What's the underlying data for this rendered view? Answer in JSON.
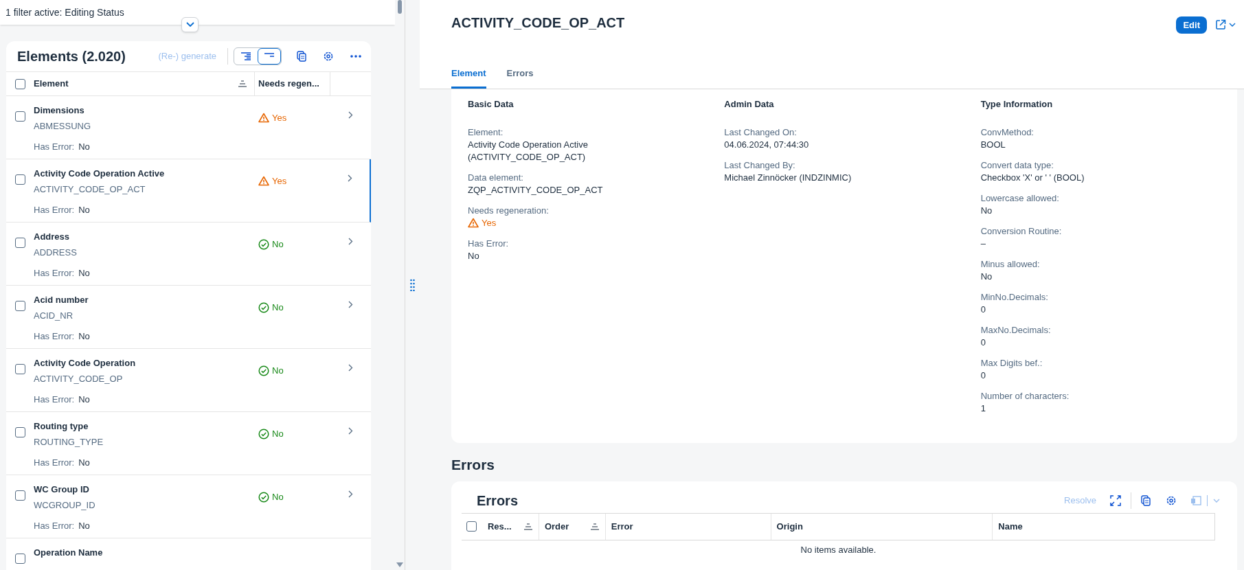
{
  "filter_bar": {
    "text": "1 filter active: Editing Status"
  },
  "elements_table": {
    "title": "Elements (2.020)",
    "generate_button": "(Re-) generate",
    "view_modes": [
      {
        "selected": false
      },
      {
        "selected": true
      }
    ],
    "select_all_checked": false,
    "columns": [
      "Element",
      "Needs regen..."
    ],
    "rows": [
      {
        "name": "Dimensions",
        "code": "ABMESSUNG",
        "needs_regeneration": true,
        "status": "Yes",
        "has_error_label": "Has Error:",
        "has_error": "No",
        "selected": false
      },
      {
        "name": "Activity Code Operation Active",
        "code": "ACTIVITY_CODE_OP_ACT",
        "needs_regeneration": true,
        "status": "Yes",
        "has_error_label": "Has Error:",
        "has_error": "No",
        "selected": true
      },
      {
        "name": "Address",
        "code": "ADDRESS",
        "needs_regeneration": false,
        "status": "No",
        "has_error_label": "Has Error:",
        "has_error": "No",
        "selected": false
      },
      {
        "name": "Acid number",
        "code": "ACID_NR",
        "needs_regeneration": false,
        "status": "No",
        "has_error_label": "Has Error:",
        "has_error": "No",
        "selected": false
      },
      {
        "name": "Activity Code Operation",
        "code": "ACTIVITY_CODE_OP",
        "needs_regeneration": false,
        "status": "No",
        "has_error_label": "Has Error:",
        "has_error": "No",
        "selected": false
      },
      {
        "name": "Routing type",
        "code": "ROUTING_TYPE",
        "needs_regeneration": false,
        "status": "No",
        "has_error_label": "Has Error:",
        "has_error": "No",
        "selected": false
      },
      {
        "name": "WC Group ID",
        "code": "WCGROUP_ID",
        "needs_regeneration": false,
        "status": "No",
        "has_error_label": "Has Error:",
        "has_error": "No",
        "selected": false
      },
      {
        "name": "Operation Name",
        "selected": false
      }
    ]
  },
  "detail": {
    "title": "ACTIVITY_CODE_OP_ACT",
    "edit_button": "Edit",
    "tabs": [
      {
        "label": "Element",
        "selected": true
      },
      {
        "label": "Errors",
        "selected": false
      }
    ],
    "groups": [
      {
        "title": "Basic Data",
        "fields": [
          {
            "label": "Element:",
            "value": "Activity Code Operation Active (ACTIVITY_CODE_OP_ACT)",
            "kind": "text"
          },
          {
            "label": "Data element:",
            "value": "ZQP_ACTIVITY_CODE_OP_ACT",
            "kind": "text"
          },
          {
            "label": "Needs regeneration:",
            "value": "Yes",
            "kind": "warning"
          },
          {
            "label": "Has Error:",
            "value": "No",
            "kind": "text"
          }
        ]
      },
      {
        "title": "Admin Data",
        "fields": [
          {
            "label": "Last Changed On:",
            "value": "04.06.2024, 07:44:30",
            "kind": "text"
          },
          {
            "label": "Last Changed By:",
            "value": "Michael Zinnöcker (INDZINMIC)",
            "kind": "text"
          }
        ]
      },
      {
        "title": "Type Information",
        "fields": [
          {
            "label": "ConvMethod:",
            "value": "BOOL",
            "kind": "text"
          },
          {
            "label": "Convert data type:",
            "value": "Checkbox 'X' or ' ' (BOOL)",
            "kind": "text"
          },
          {
            "label": "Lowercase allowed:",
            "value": "No",
            "kind": "text"
          },
          {
            "label": "Conversion Routine:",
            "value": "–",
            "kind": "text"
          },
          {
            "label": "Minus allowed:",
            "value": "No",
            "kind": "text"
          },
          {
            "label": "MinNo.Decimals:",
            "value": "0",
            "kind": "text"
          },
          {
            "label": "MaxNo.Decimals:",
            "value": "0",
            "kind": "text"
          },
          {
            "label": "Max Digits bef.:",
            "value": "0",
            "kind": "text"
          },
          {
            "label": "Number of characters:",
            "value": "1",
            "kind": "text"
          }
        ]
      }
    ],
    "errors_section": {
      "heading": "Errors",
      "table_title": "Errors",
      "resolve_button": "Resolve",
      "select_all_checked": false,
      "columns": [
        {
          "label": "Res...",
          "sortable": true
        },
        {
          "label": "Order",
          "sortable": true
        },
        {
          "label": "Error",
          "sortable": false
        },
        {
          "label": "Origin",
          "sortable": false
        },
        {
          "label": "Name",
          "sortable": false
        }
      ],
      "empty_text": "No items available."
    }
  }
}
